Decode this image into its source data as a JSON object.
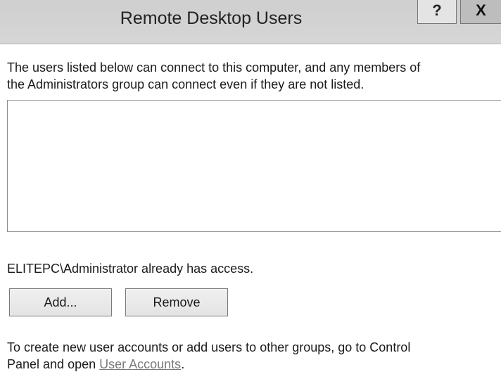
{
  "window": {
    "title": "Remote Desktop Users",
    "help_label": "?",
    "close_label": "X"
  },
  "intro": {
    "line1": "The users listed below can connect to this computer, and any members of",
    "line2": "the Administrators group can connect even if they are not listed."
  },
  "user_list": {
    "items": []
  },
  "access_status": "ELITEPC\\Administrator already has access.",
  "buttons": {
    "add_label": "Add...",
    "remove_label": "Remove"
  },
  "footer": {
    "line1": "To create new user accounts or add users to other groups, go to Control",
    "line2_prefix": "Panel and open ",
    "link_label": "User Accounts",
    "line2_suffix": "."
  }
}
